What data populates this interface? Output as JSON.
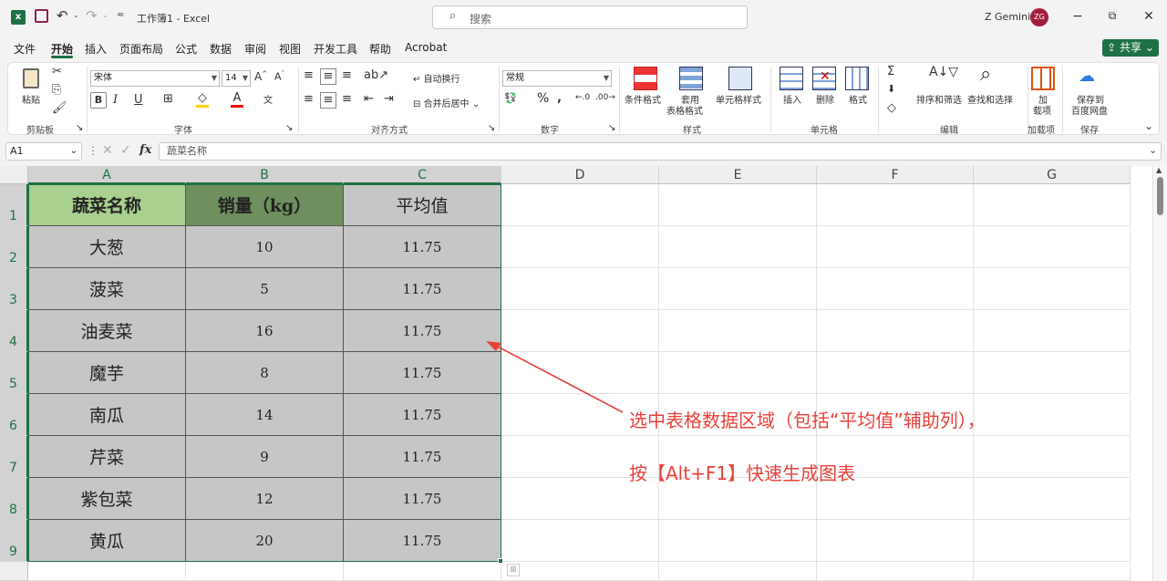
{
  "titlebar": {
    "title": "工作簿1 - Excel",
    "search_placeholder": "搜索",
    "user_name": "Z Gemini",
    "user_initials": "ZG"
  },
  "menu": {
    "items": [
      "文件",
      "开始",
      "插入",
      "页面布局",
      "公式",
      "数据",
      "审阅",
      "视图",
      "开发工具",
      "帮助",
      "Acrobat"
    ],
    "active": "开始",
    "share_label": "共享"
  },
  "ribbon": {
    "clipboard": {
      "paste": "粘贴",
      "group": "剪贴板"
    },
    "font": {
      "name": "宋体",
      "size": "14",
      "group": "字体"
    },
    "alignment": {
      "wrap": "自动换行",
      "merge": "合并后居中",
      "group": "对齐方式"
    },
    "number": {
      "format": "常规",
      "group": "数字"
    },
    "styles": {
      "conditional": "条件格式",
      "table_1": "套用",
      "table_2": "表格格式",
      "cell_styles": "单元格样式",
      "group": "样式"
    },
    "cells": {
      "insert": "插入",
      "delete": "删除",
      "format": "格式",
      "group": "单元格"
    },
    "editing": {
      "sort": "排序和筛选",
      "find": "查找和选择",
      "group": "编辑"
    },
    "addins": {
      "line1": "加",
      "line2": "载项",
      "group": "加载项"
    },
    "save": {
      "line1": "保存到",
      "line2": "百度网盘",
      "group": "保存"
    }
  },
  "formula_bar": {
    "name_box": "A1",
    "fx": "fx",
    "content": "蔬菜名称"
  },
  "sheet": {
    "columns": [
      "A",
      "B",
      "C",
      "D",
      "E",
      "F",
      "G"
    ],
    "rows": [
      "1",
      "2",
      "3",
      "4",
      "5",
      "6",
      "7",
      "8",
      "9"
    ],
    "headers": [
      "蔬菜名称",
      "销量（kg）",
      "平均值"
    ],
    "data": [
      [
        "大葱",
        "10",
        "11.75"
      ],
      [
        "菠菜",
        "5",
        "11.75"
      ],
      [
        "油麦菜",
        "16",
        "11.75"
      ],
      [
        "魔芋",
        "8",
        "11.75"
      ],
      [
        "南瓜",
        "14",
        "11.75"
      ],
      [
        "芹菜",
        "9",
        "11.75"
      ],
      [
        "紫包菜",
        "12",
        "11.75"
      ],
      [
        "黄瓜",
        "20",
        "11.75"
      ]
    ]
  },
  "annotation": {
    "line1": "选中表格数据区域（包括“平均值”辅助列），",
    "line2": "按【Alt+F1】快速生成图表",
    "color": "#e8413a"
  }
}
